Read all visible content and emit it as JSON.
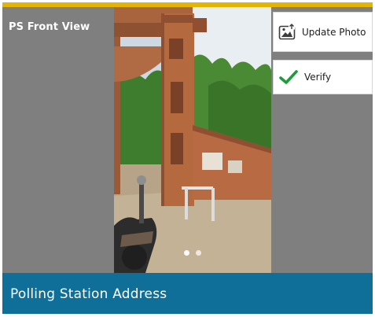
{
  "header": {
    "title": "PS Front View"
  },
  "actions": {
    "update_photo_label": "Update Photo",
    "update_photo_icon": "image-upload-icon",
    "verify_label": "Verify",
    "verify_icon": "checkmark-icon",
    "verify_icon_color": "#1e9c3b"
  },
  "carousel": {
    "page_count": 2,
    "active_index": 0
  },
  "footer": {
    "label": "Polling Station Address"
  },
  "colors": {
    "accent": "#e3b400",
    "footer_background": "#0f6f98",
    "panel_background": "#7f7f7f"
  }
}
